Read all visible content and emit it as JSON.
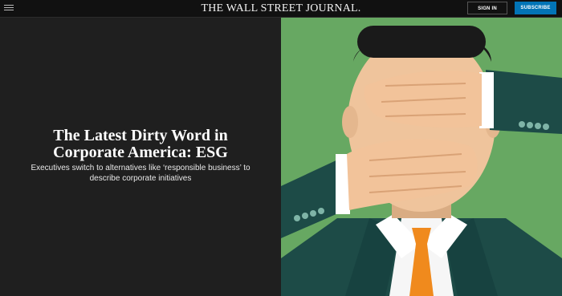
{
  "header": {
    "masthead": "THE WALL STREET JOURNAL.",
    "signin_label": "SIGN IN",
    "subscribe_label": "SUBSCRIBE"
  },
  "article": {
    "headline": "The Latest Dirty Word in Corporate America: ESG",
    "dek": "Executives switch to alternatives like ‘responsible business’ to describe corporate initiatives"
  },
  "colors": {
    "background": "#1f1f1f",
    "topbar": "#111111",
    "subscribe_blue": "#0274b6",
    "art_green": "#67a862",
    "suit": "#1d4b47",
    "skin": "#efc49c",
    "tie": "#f08a1d"
  }
}
